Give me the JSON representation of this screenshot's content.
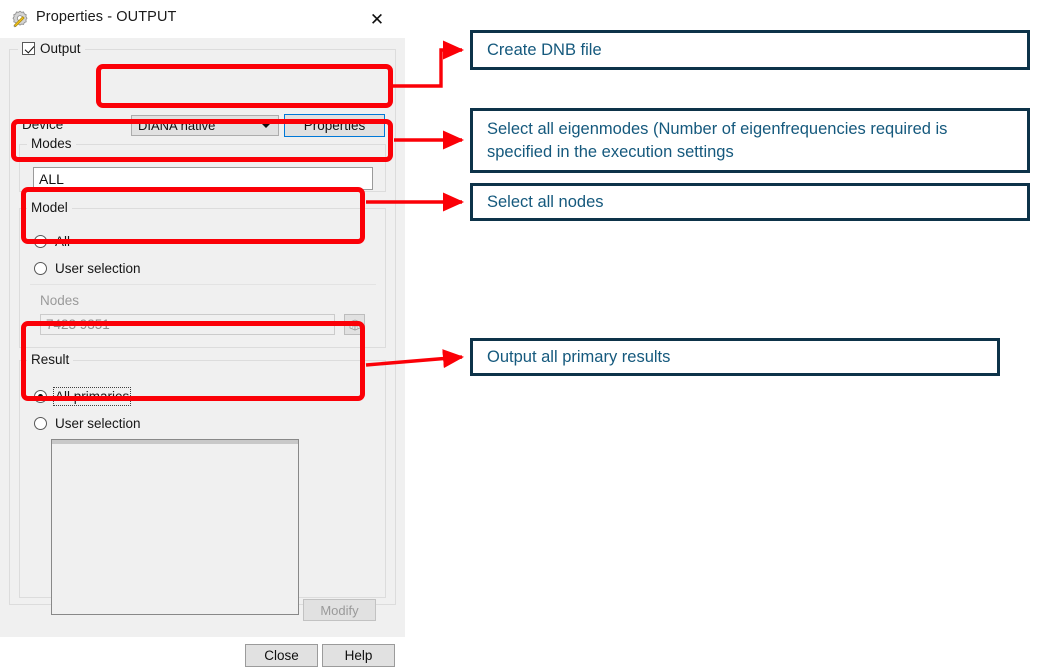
{
  "window": {
    "title": "Properties - OUTPUT",
    "icon": "properties-gear-pencil-icon",
    "close_label": "✕"
  },
  "dialog": {
    "output_group": {
      "legend": "Output",
      "checked": true
    },
    "device": {
      "label": "Device",
      "combo_value": "DIANA native",
      "combo_options": [
        "DIANA native"
      ],
      "properties_button": "Properties"
    },
    "modes": {
      "legend": "Modes",
      "value": "ALL",
      "placeholder": ""
    },
    "model": {
      "legend": "Model",
      "options": [
        {
          "label": "All",
          "selected": true
        },
        {
          "label": "User selection",
          "selected": false
        }
      ],
      "nodes_label": "Nodes",
      "nodes_value": "7423 9351",
      "nodes_pick_icon": "node-picker-grid-icon"
    },
    "result": {
      "legend": "Result",
      "options": [
        {
          "label": "All primaries",
          "selected": true,
          "focused": true
        },
        {
          "label": "User selection",
          "selected": false
        }
      ],
      "list_items": [],
      "modify_button": "Modify"
    },
    "footer": {
      "close_button": "Close",
      "help_button": "Help"
    }
  },
  "annotations": {
    "highlight_color": "#fb0007",
    "callout_border_color": "#0d3349",
    "callout_text_color": "#15597d",
    "callouts": [
      {
        "id": "dnb",
        "text": "Create DNB file"
      },
      {
        "id": "eigen",
        "text": "Select all eigenmodes (Number of eigenfrequencies required is specified in the execution settings"
      },
      {
        "id": "nodes",
        "text": "Select all nodes"
      },
      {
        "id": "primary",
        "text": "Output all primary results"
      }
    ]
  }
}
